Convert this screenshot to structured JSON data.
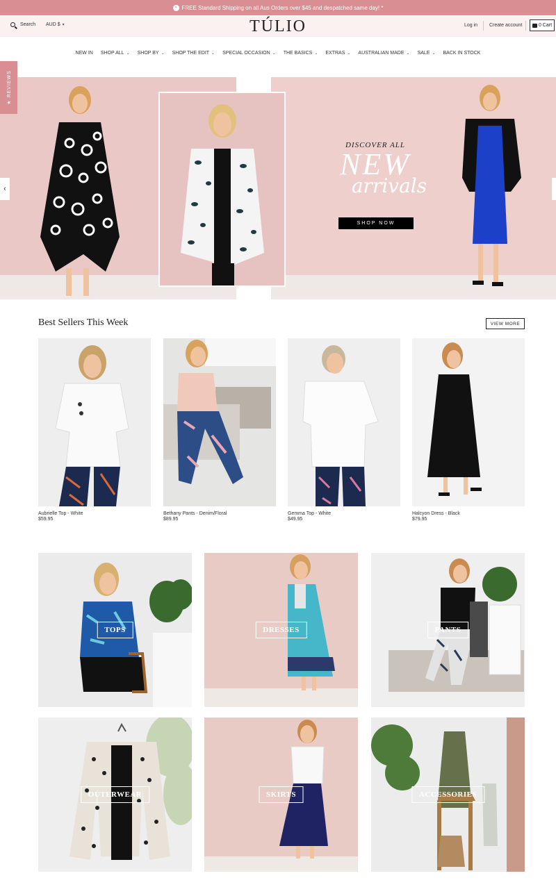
{
  "announcement": {
    "text": "FREE Standard Shipping on all Aus Orders over $45 and despatched same day! *"
  },
  "header": {
    "search_label": "Search",
    "currency": "AUD $",
    "logo": "TÚLIO",
    "login": "Log in",
    "create_account": "Create account",
    "cart": "0 Cart"
  },
  "nav": {
    "items": [
      {
        "label": "NEW IN",
        "dropdown": false
      },
      {
        "label": "SHOP ALL",
        "dropdown": true
      },
      {
        "label": "SHOP BY",
        "dropdown": true
      },
      {
        "label": "SHOP THE EDIT",
        "dropdown": true
      },
      {
        "label": "SPECIAL OCCASION",
        "dropdown": true
      },
      {
        "label": "THE BASICS",
        "dropdown": true
      },
      {
        "label": "EXTRAS",
        "dropdown": true
      },
      {
        "label": "AUSTRALIAN MADE",
        "dropdown": true
      },
      {
        "label": "SALE",
        "dropdown": true
      },
      {
        "label": "BACK IN STOCK",
        "dropdown": false
      }
    ]
  },
  "reviews_tab": "★ REVIEWS",
  "hero": {
    "subtitle": "DISCOVER ALL",
    "title": "NEW",
    "script": "arrivals",
    "button": "SHOP NOW"
  },
  "best_sellers": {
    "title": "Best Sellers This Week",
    "view_more": "VIEW MORE",
    "products": [
      {
        "name": "Aubrielle Top - White",
        "price": "$59.95"
      },
      {
        "name": "Bethany Pants - Denim/Floral",
        "price": "$89.95"
      },
      {
        "name": "Gemma Top - White",
        "price": "$49.95"
      },
      {
        "name": "Halcyon Dress - Black",
        "price": "$79.95"
      }
    ]
  },
  "categories": [
    {
      "label": "TOPS"
    },
    {
      "label": "DRESSES"
    },
    {
      "label": "PANTS"
    },
    {
      "label": "OUTERWEAR"
    },
    {
      "label": "SKIRTS"
    },
    {
      "label": "ACCESSORIES"
    }
  ],
  "colors": {
    "accent": "#d98e93",
    "header_bg": "#fbf1f0",
    "hero_pink": "#eac8c5"
  }
}
